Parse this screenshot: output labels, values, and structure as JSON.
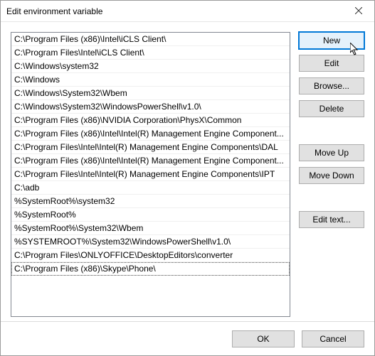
{
  "window": {
    "title": "Edit environment variable"
  },
  "list": {
    "items": [
      "C:\\Program Files (x86)\\Intel\\iCLS Client\\",
      "C:\\Program Files\\Intel\\iCLS Client\\",
      "C:\\Windows\\system32",
      "C:\\Windows",
      "C:\\Windows\\System32\\Wbem",
      "C:\\Windows\\System32\\WindowsPowerShell\\v1.0\\",
      "C:\\Program Files (x86)\\NVIDIA Corporation\\PhysX\\Common",
      "C:\\Program Files (x86)\\Intel\\Intel(R) Management Engine Component...",
      "C:\\Program Files\\Intel\\Intel(R) Management Engine Components\\DAL",
      "C:\\Program Files (x86)\\Intel\\Intel(R) Management Engine Component...",
      "C:\\Program Files\\Intel\\Intel(R) Management Engine Components\\IPT",
      "C:\\adb",
      "%SystemRoot%\\system32",
      "%SystemRoot%",
      "%SystemRoot%\\System32\\Wbem",
      "%SYSTEMROOT%\\System32\\WindowsPowerShell\\v1.0\\",
      "C:\\Program Files\\ONLYOFFICE\\DesktopEditors\\converter",
      "C:\\Program Files (x86)\\Skype\\Phone\\"
    ],
    "selected_index": 17
  },
  "buttons": {
    "new": "New",
    "edit": "Edit",
    "browse": "Browse...",
    "delete": "Delete",
    "move_up": "Move Up",
    "move_down": "Move Down",
    "edit_text": "Edit text...",
    "ok": "OK",
    "cancel": "Cancel"
  }
}
